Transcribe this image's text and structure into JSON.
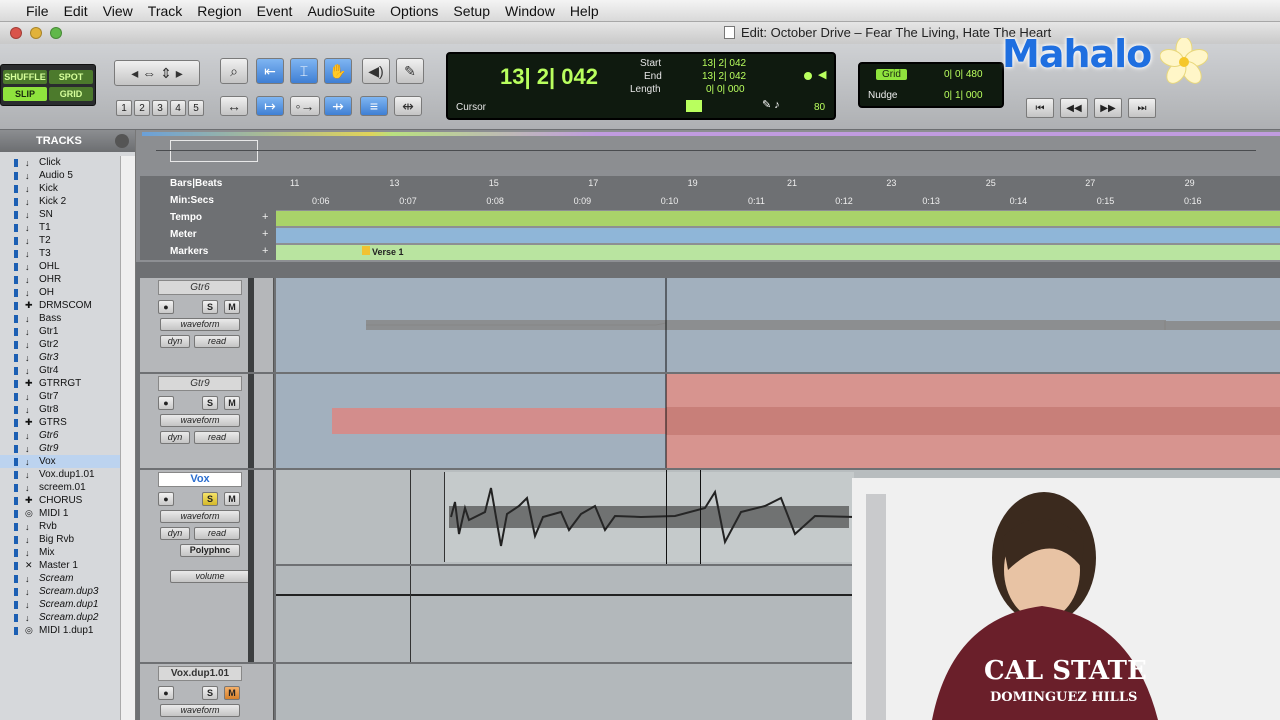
{
  "menu": {
    "apple": "",
    "items": [
      "File",
      "Edit",
      "View",
      "Track",
      "Region",
      "Event",
      "AudioSuite",
      "Options",
      "Setup",
      "Window",
      "Help"
    ]
  },
  "window": {
    "title": "Edit: October Drive – Fear The Living, Hate The Heart"
  },
  "modes": {
    "shuffle": "SHUFFLE",
    "spot": "SPOT",
    "slip": "SLIP",
    "grid": "GRID"
  },
  "zoom_presets": [
    "1",
    "2",
    "3",
    "4",
    "5"
  ],
  "counter": {
    "main": "13| 2| 042",
    "start_label": "Start",
    "end_label": "End",
    "length_label": "Length",
    "start": "13| 2| 042",
    "end": "13| 2| 042",
    "length": "0| 0| 000",
    "cursor_label": "Cursor",
    "tempo": "80"
  },
  "grid": {
    "grid_label": "Grid",
    "grid_value": "0| 0| 480",
    "nudge_label": "Nudge",
    "nudge_value": "0| 1| 000"
  },
  "logo": {
    "text": "Mahalo"
  },
  "tracks_panel": {
    "title": "TRACKS",
    "items": [
      {
        "name": "Click",
        "icon": "↓",
        "italic": false,
        "selected": false
      },
      {
        "name": "Audio 5",
        "icon": "↓",
        "italic": false,
        "selected": false
      },
      {
        "name": "Kick",
        "icon": "↓",
        "italic": false,
        "selected": false
      },
      {
        "name": "Kick 2",
        "icon": "↓",
        "italic": false,
        "selected": false
      },
      {
        "name": "SN",
        "icon": "↓",
        "italic": false,
        "selected": false
      },
      {
        "name": "T1",
        "icon": "↓",
        "italic": false,
        "selected": false
      },
      {
        "name": "T2",
        "icon": "↓",
        "italic": false,
        "selected": false
      },
      {
        "name": "T3",
        "icon": "↓",
        "italic": false,
        "selected": false
      },
      {
        "name": "OHL",
        "icon": "↓",
        "italic": false,
        "selected": false
      },
      {
        "name": "OHR",
        "icon": "↓",
        "italic": false,
        "selected": false
      },
      {
        "name": "OH",
        "icon": "↓",
        "italic": false,
        "selected": false
      },
      {
        "name": "DRMSCOM",
        "icon": "✚",
        "italic": false,
        "selected": false
      },
      {
        "name": "Bass",
        "icon": "↓",
        "italic": false,
        "selected": false
      },
      {
        "name": "Gtr1",
        "icon": "↓",
        "italic": false,
        "selected": false
      },
      {
        "name": "Gtr2",
        "icon": "↓",
        "italic": false,
        "selected": false
      },
      {
        "name": "Gtr3",
        "icon": "↓",
        "italic": true,
        "selected": false
      },
      {
        "name": "Gtr4",
        "icon": "↓",
        "italic": false,
        "selected": false
      },
      {
        "name": "GTRRGT",
        "icon": "✚",
        "italic": false,
        "selected": false
      },
      {
        "name": "Gtr7",
        "icon": "↓",
        "italic": false,
        "selected": false
      },
      {
        "name": "Gtr8",
        "icon": "↓",
        "italic": false,
        "selected": false
      },
      {
        "name": "GTRS",
        "icon": "✚",
        "italic": false,
        "selected": false
      },
      {
        "name": "Gtr6",
        "icon": "↓",
        "italic": true,
        "selected": false
      },
      {
        "name": "Gtr9",
        "icon": "↓",
        "italic": true,
        "selected": false
      },
      {
        "name": "Vox",
        "icon": "↓",
        "italic": false,
        "selected": true
      },
      {
        "name": "Vox.dup1.01",
        "icon": "↓",
        "italic": false,
        "selected": false
      },
      {
        "name": "screem.01",
        "icon": "↓",
        "italic": false,
        "selected": false
      },
      {
        "name": "CHORUS",
        "icon": "✚",
        "italic": false,
        "selected": false
      },
      {
        "name": "MIDI 1",
        "icon": "◎",
        "italic": false,
        "selected": false
      },
      {
        "name": "Rvb",
        "icon": "↓",
        "italic": false,
        "selected": false
      },
      {
        "name": "Big Rvb",
        "icon": "↓",
        "italic": false,
        "selected": false
      },
      {
        "name": "Mix",
        "icon": "↓",
        "italic": false,
        "selected": false
      },
      {
        "name": "Master 1",
        "icon": "✕",
        "italic": false,
        "selected": false
      },
      {
        "name": "Scream",
        "icon": "↓",
        "italic": true,
        "selected": false
      },
      {
        "name": "Scream.dup3",
        "icon": "↓",
        "italic": true,
        "selected": false
      },
      {
        "name": "Scream.dup1",
        "icon": "↓",
        "italic": true,
        "selected": false
      },
      {
        "name": "Scream.dup2",
        "icon": "↓",
        "italic": true,
        "selected": false
      },
      {
        "name": "MIDI 1.dup1",
        "icon": "◎",
        "italic": false,
        "selected": false
      }
    ]
  },
  "rulers": {
    "bars_label": "Bars|Beats",
    "minsecs_label": "Min:Secs",
    "tempo_label": "Tempo",
    "meter_label": "Meter",
    "markers_label": "Markers",
    "bars": [
      "11",
      "13",
      "15",
      "17",
      "19",
      "21",
      "23",
      "25",
      "27",
      "29"
    ],
    "secs": [
      "0:06",
      "0:07",
      "0:08",
      "0:09",
      "0:10",
      "0:11",
      "0:12",
      "0:13",
      "0:14",
      "0:15",
      "0:16"
    ],
    "marker_name": "Verse 1"
  },
  "edit_tracks": [
    {
      "name": "Gtr6",
      "view": "waveform",
      "dyn": "dyn",
      "auto": "read"
    },
    {
      "name": "Gtr9",
      "view": "waveform",
      "dyn": "dyn",
      "auto": "read"
    },
    {
      "name": "Vox",
      "view": "waveform",
      "dyn": "dyn",
      "auto": "read",
      "plugin": "Polyphnc",
      "lane_view": "volume"
    },
    {
      "name": "Vox.dup1.01",
      "view": "waveform"
    }
  ],
  "button_letters": {
    "solo": "S",
    "mute": "M"
  },
  "shirt": {
    "line1": "CAL STATE",
    "line2": "DOMINGUEZ HILLS"
  },
  "colors": {
    "accent_blue": "#3f7fd4",
    "counter_green": "#b9ff5e",
    "region_blue": "#a2b0be",
    "region_red": "#d7948f",
    "tempo_green": "#a9d36a",
    "meter_blue": "#8fb6d8",
    "marker_green": "#b9e4a0"
  }
}
